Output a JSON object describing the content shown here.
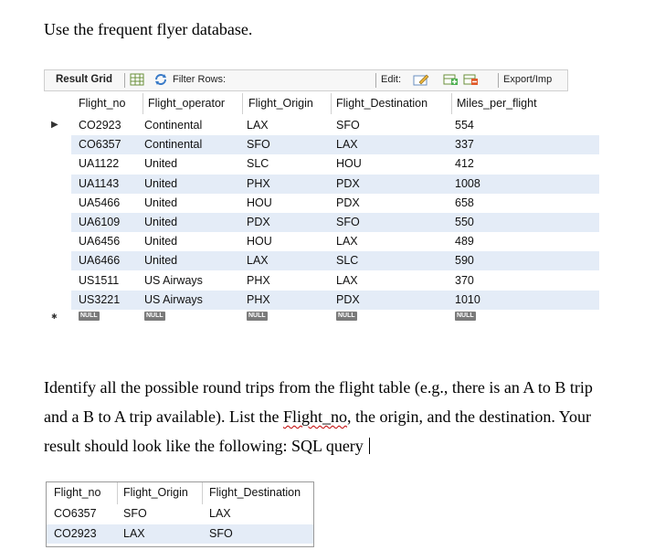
{
  "intro": "Use the frequent flyer database.",
  "toolbar": {
    "result_grid": "Result Grid",
    "filter_rows": "Filter Rows:",
    "edit": "Edit:",
    "export": "Export/Imp"
  },
  "grid": {
    "columns": [
      "Flight_no",
      "Flight_operator",
      "Flight_Origin",
      "Flight_Destination",
      "Miles_per_flight"
    ],
    "rows": [
      [
        "CO2923",
        "Continental",
        "LAX",
        "SFO",
        "554"
      ],
      [
        "CO6357",
        "Continental",
        "SFO",
        "LAX",
        "337"
      ],
      [
        "UA1122",
        "United",
        "SLC",
        "HOU",
        "412"
      ],
      [
        "UA1143",
        "United",
        "PHX",
        "PDX",
        "1008"
      ],
      [
        "UA5466",
        "United",
        "HOU",
        "PDX",
        "658"
      ],
      [
        "UA6109",
        "United",
        "PDX",
        "SFO",
        "550"
      ],
      [
        "UA6456",
        "United",
        "HOU",
        "LAX",
        "489"
      ],
      [
        "UA6466",
        "United",
        "LAX",
        "SLC",
        "590"
      ],
      [
        "US1511",
        "US Airways",
        "PHX",
        "LAX",
        "370"
      ],
      [
        "US3221",
        "US Airways",
        "PHX",
        "PDX",
        "1010"
      ]
    ],
    "null_label": "NULL"
  },
  "para": {
    "line1": "Identify all the possible round trips from the flight table (e.g., there is an A to B trip",
    "line2_a": "and a B to A trip available). List the ",
    "line2_flagged": "Flight_no",
    "line2_b": ", the origin, and the destination. Your",
    "line3": "result should look like the following: SQL query"
  },
  "sample": {
    "columns": [
      "Flight_no",
      "Flight_Origin",
      "Flight_Destination"
    ],
    "rows": [
      [
        "CO6357",
        "SFO",
        "LAX"
      ],
      [
        "CO2923",
        "LAX",
        "SFO"
      ]
    ]
  }
}
